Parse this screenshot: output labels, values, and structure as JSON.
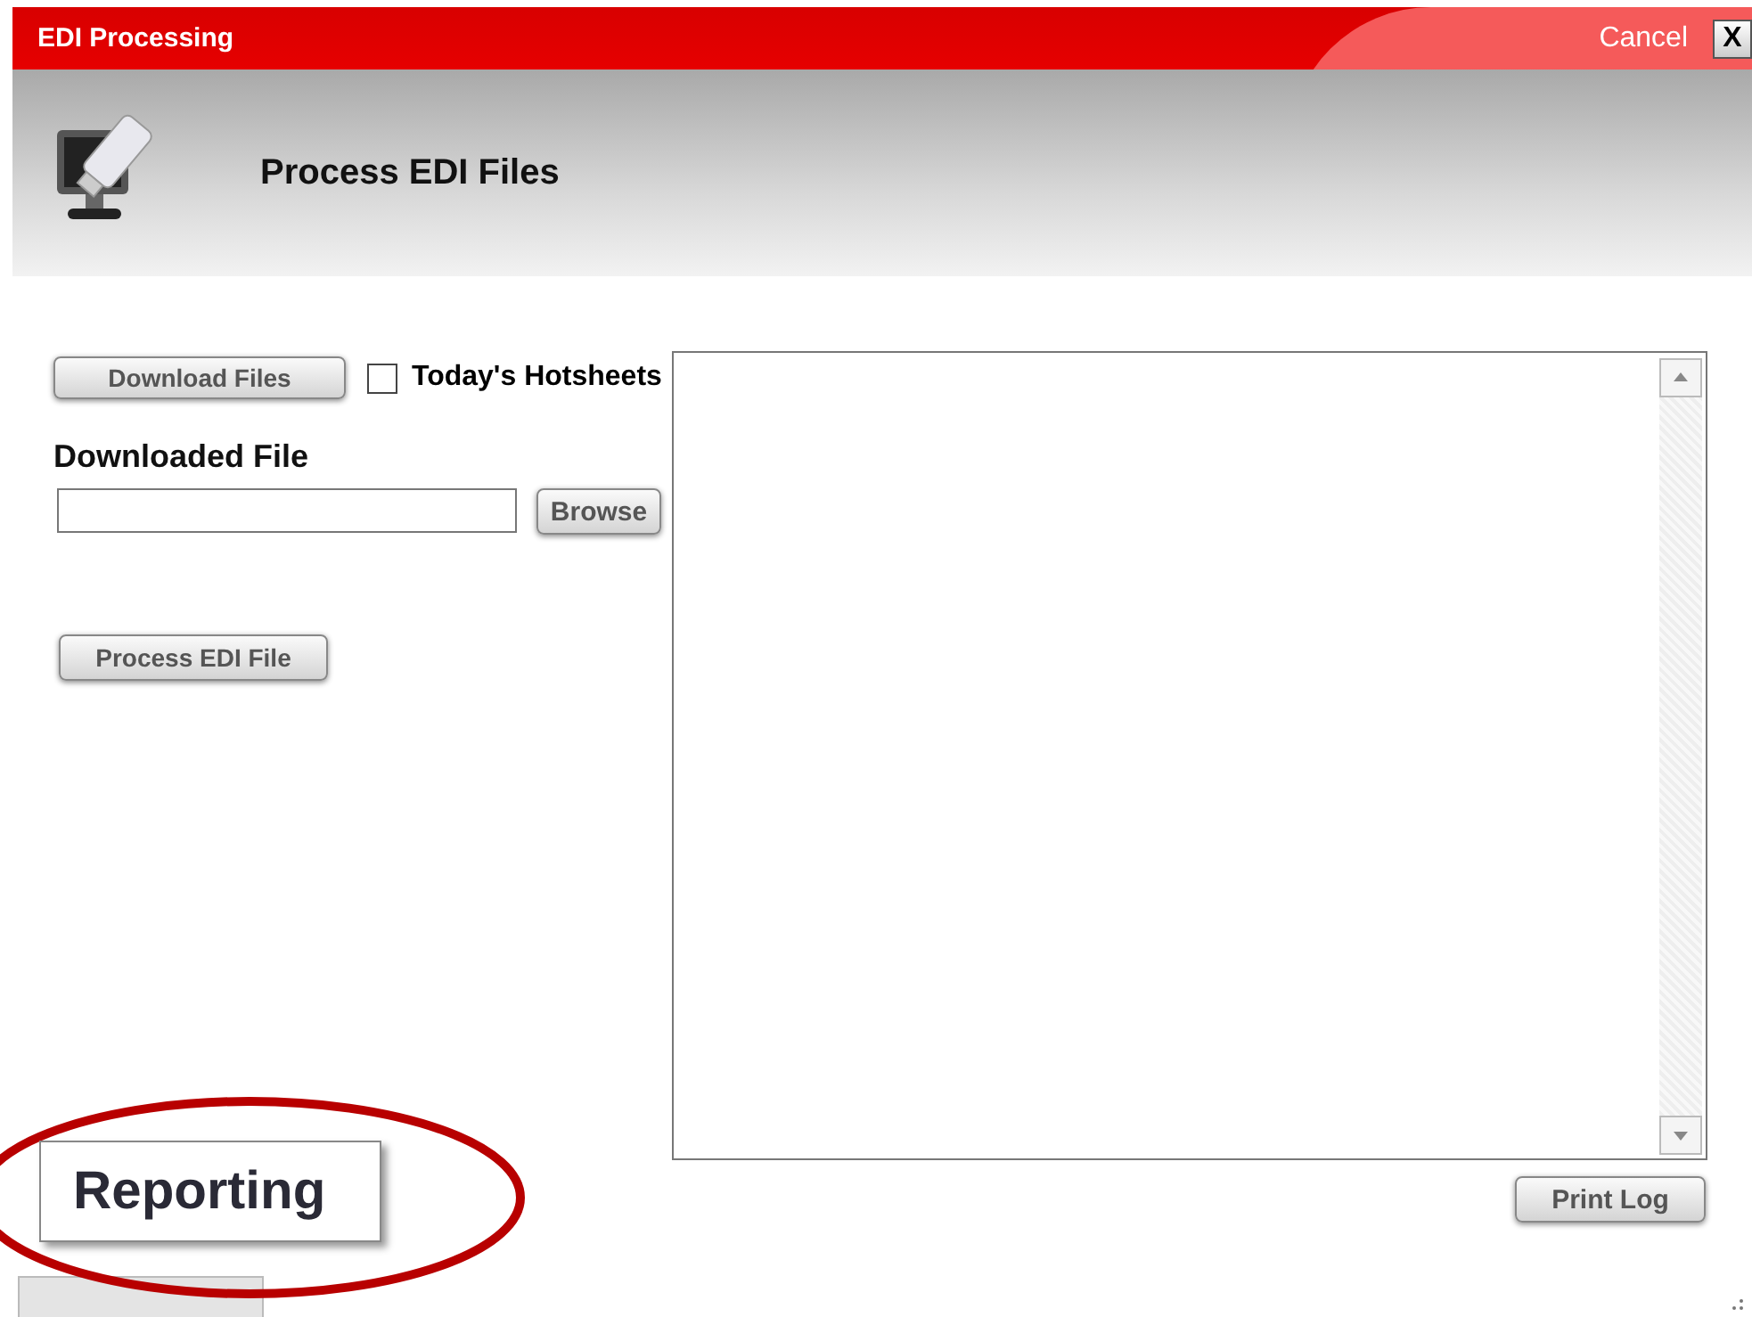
{
  "window": {
    "title": "EDI Processing",
    "cancel_label": "Cancel",
    "close_label": "X"
  },
  "header": {
    "title": "Process EDI Files"
  },
  "download_button": "Download Files",
  "hotsheets": {
    "label": "Today's Hotsheets",
    "checked": false
  },
  "downloaded_file": {
    "label": "Downloaded File",
    "browse_button": "Browse"
  },
  "process_button": "Process EDI File",
  "log": {
    "print_button": "Print Log"
  },
  "callout": {
    "label": "Reporting"
  }
}
